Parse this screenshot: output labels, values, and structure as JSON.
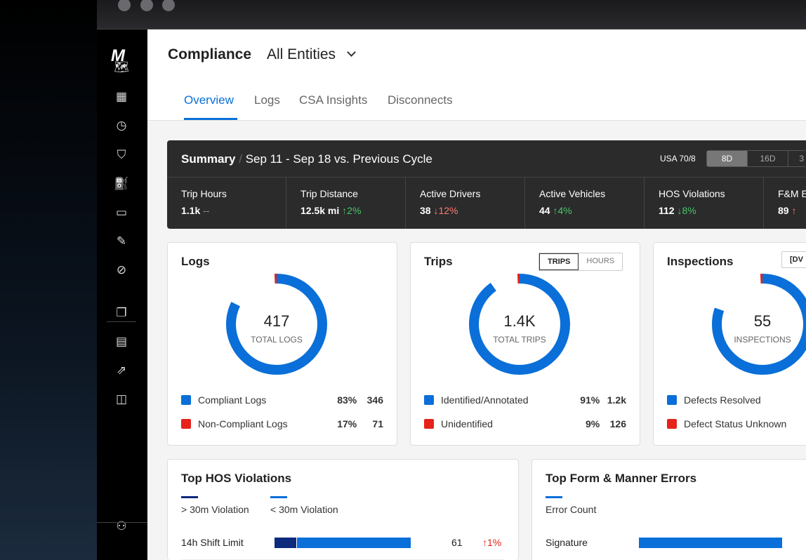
{
  "window": {
    "controls": [
      "close",
      "minimize",
      "maximize"
    ]
  },
  "sidebar": {
    "logo": "M",
    "items": [
      "map-icon",
      "dashboard-icon",
      "clock-icon",
      "shield-icon",
      "fuel-icon",
      "card-icon",
      "wrench-icon",
      "tag-icon",
      "chat-icon",
      "document-icon",
      "analytics-icon",
      "bag-icon",
      "user-settings-icon"
    ]
  },
  "header": {
    "title": "Compliance",
    "entity": "All Entities",
    "tabs": [
      "Overview",
      "Logs",
      "CSA Insights",
      "Disconnects"
    ],
    "active_tab": "Overview"
  },
  "summary": {
    "title": "Summary",
    "range": "Sep 11 - Sep 18 vs. Previous Cycle",
    "ruleset": "USA 70/8",
    "periods": [
      "8D",
      "16D",
      "3"
    ],
    "active_period": "8D",
    "stats": [
      {
        "label": "Trip Hours",
        "value": "1.1k",
        "change": "--",
        "dir": "none"
      },
      {
        "label": "Trip Distance",
        "value": "12.5k mi",
        "change": "↑2%",
        "dir": "up"
      },
      {
        "label": "Active Drivers",
        "value": "38",
        "change": "↓12%",
        "dir": "down"
      },
      {
        "label": "Active Vehicles",
        "value": "44",
        "change": "↑4%",
        "dir": "up"
      },
      {
        "label": "HOS Violations",
        "value": "112",
        "change": "↓8%",
        "dir": "up"
      },
      {
        "label": "F&M E",
        "value": "89",
        "change": "↑",
        "dir": "down"
      }
    ]
  },
  "colors": {
    "blue": "#0a6fd8",
    "red": "#e5231b",
    "navy": "#0d2a7d"
  },
  "cards": {
    "logs": {
      "title": "Logs",
      "total": "417",
      "total_label": "TOTAL LOGS",
      "fraction_red": 0.17,
      "legend": [
        {
          "label": "Compliant Logs",
          "pct": "83%",
          "count": "346",
          "color": "#0a6fd8"
        },
        {
          "label": "Non-Compliant Logs",
          "pct": "17%",
          "count": "71",
          "color": "#e5231b"
        }
      ]
    },
    "trips": {
      "title": "Trips",
      "toggle": [
        "TRIPS",
        "HOURS"
      ],
      "active": "TRIPS",
      "total": "1.4K",
      "total_label": "TOTAL TRIPS",
      "fraction_red": 0.09,
      "legend": [
        {
          "label": "Identified/Annotated",
          "pct": "91%",
          "count": "1.2k",
          "color": "#0a6fd8"
        },
        {
          "label": "Unidentified",
          "pct": "9%",
          "count": "126",
          "color": "#e5231b"
        }
      ]
    },
    "inspections": {
      "title": "Inspections",
      "toggle": "[DV",
      "total": "55",
      "total_label": "INSPECTIONS",
      "fraction_red": 0.19,
      "legend": [
        {
          "label": "Defects Resolved",
          "color": "#0a6fd8"
        },
        {
          "label": "Defect Status Unknown",
          "color": "#e5231b"
        }
      ]
    }
  },
  "hos": {
    "title": "Top HOS Violations",
    "legend": [
      "> 30m Violation",
      "< 30m Violation"
    ],
    "rows": [
      {
        "label": "14h Shift Limit",
        "over": 10,
        "under": 51,
        "total": "61",
        "change": "↑1%"
      }
    ]
  },
  "fm": {
    "title": "Top Form & Manner Errors",
    "legend": "Error Count",
    "rows": [
      {
        "label": "Signature"
      }
    ]
  }
}
